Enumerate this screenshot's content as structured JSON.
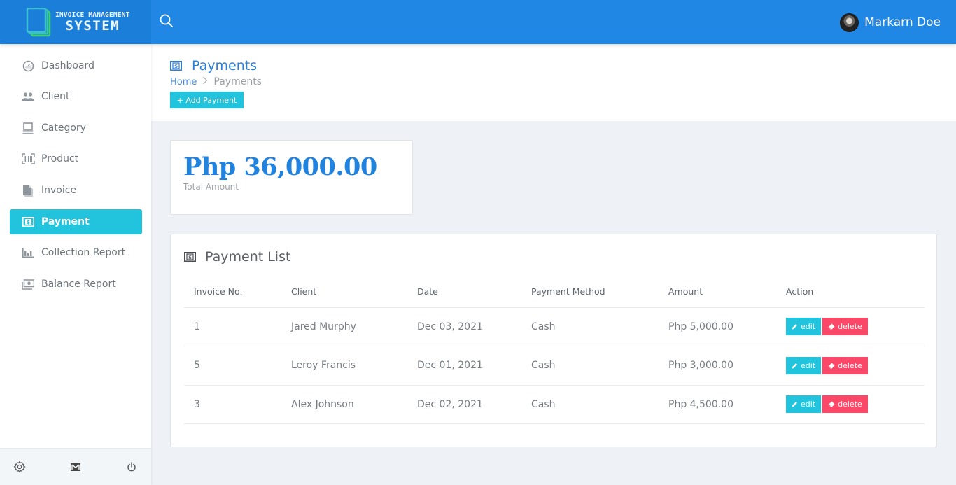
{
  "app": {
    "brand_line1": "INVOICE MANAGEMENT",
    "brand_line2": "SYSTEM",
    "user_name": "Markarn Doe"
  },
  "sidebar": {
    "items": [
      {
        "label": "Dashboard",
        "icon": "dashboard-gauge-icon",
        "active": false
      },
      {
        "label": "Client",
        "icon": "users-icon",
        "active": false
      },
      {
        "label": "Category",
        "icon": "laptop-icon",
        "active": false
      },
      {
        "label": "Product",
        "icon": "barcode-icon",
        "active": false
      },
      {
        "label": "Invoice",
        "icon": "file-icon",
        "active": false
      },
      {
        "label": "Payment",
        "icon": "money-bill-icon",
        "active": true
      },
      {
        "label": "Collection Report",
        "icon": "bar-chart-icon",
        "active": false
      },
      {
        "label": "Balance Report",
        "icon": "money-stack-icon",
        "active": false
      }
    ],
    "footer_icons": [
      "gear-icon",
      "mail-icon",
      "power-icon"
    ]
  },
  "page": {
    "title": "Payments",
    "breadcrumb": {
      "home": "Home",
      "current": "Payments"
    },
    "add_button": "+ Add Payment"
  },
  "summary": {
    "total_amount": "Php 36,000.00",
    "total_label": "Total Amount"
  },
  "payment_list": {
    "title": "Payment List",
    "columns": [
      "Invoice No.",
      "Client",
      "Date",
      "Payment Method",
      "Amount",
      "Action"
    ],
    "rows": [
      {
        "invoice_no": "1",
        "client": "Jared Murphy",
        "date": "Dec 03, 2021",
        "method": "Cash",
        "amount": "Php 5,000.00"
      },
      {
        "invoice_no": "5",
        "client": "Leroy Francis",
        "date": "Dec 01, 2021",
        "method": "Cash",
        "amount": "Php 3,000.00"
      },
      {
        "invoice_no": "3",
        "client": "Alex Johnson",
        "date": "Dec 02, 2021",
        "method": "Cash",
        "amount": "Php 4,500.00"
      }
    ],
    "edit_label": "edit",
    "delete_label": "delete"
  },
  "colors": {
    "primary": "#2088e4",
    "accent": "#22c3dc",
    "danger": "#fb4868",
    "total_amount": "#2183e0"
  }
}
